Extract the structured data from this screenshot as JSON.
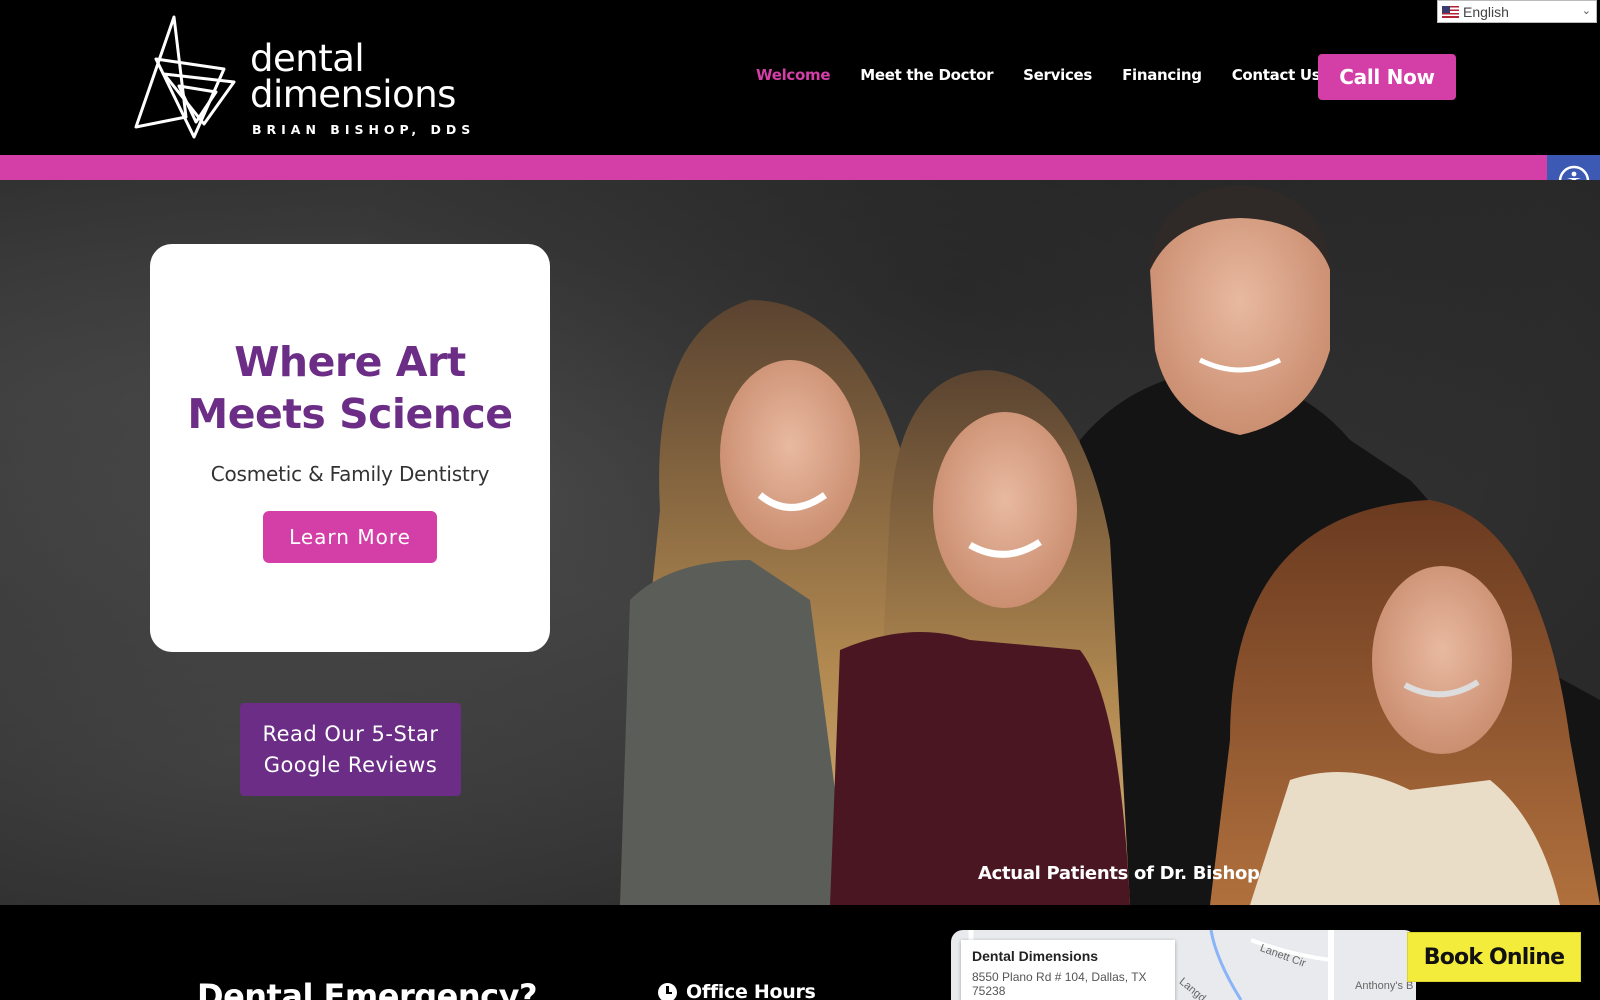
{
  "header": {
    "logo": {
      "word_line1": "dental",
      "word_line2": "dimensions",
      "subtitle": "BRIAN BISHOP, DDS"
    },
    "nav": [
      {
        "label": "Welcome",
        "active": true
      },
      {
        "label": "Meet the Doctor",
        "active": false
      },
      {
        "label": "Services",
        "active": false
      },
      {
        "label": "Financing",
        "active": false
      },
      {
        "label": "Contact Us",
        "active": false
      }
    ],
    "call_button": "Call Now",
    "language": {
      "selected": "English",
      "icon": "us-flag-icon"
    }
  },
  "accessibility": {
    "icon": "accessibility-icon"
  },
  "hero": {
    "title_line1": "Where Art",
    "title_line2": "Meets Science",
    "subtitle": "Cosmetic & Family Dentistry",
    "learn_more": "Learn More",
    "reviews_line1": "Read Our 5-Star",
    "reviews_line2": "Google Reviews",
    "caption": "Actual Patients of Dr. Bishop"
  },
  "footer": {
    "emergency_title": "Dental Emergency?",
    "office_hours": "Office Hours",
    "map": {
      "place_name": "Dental Dimensions",
      "address": "8550 Plano Rd # 104, Dallas, TX 75238",
      "street_labels": [
        "Lanett Cir",
        "Anthony's B",
        "Langd"
      ]
    },
    "book_online": "Book Online"
  },
  "colors": {
    "brand_pink": "#d43fa7",
    "brand_purple": "#6b2d86",
    "accessibility_blue": "#3c59b3",
    "book_yellow": "#f3ec3a"
  }
}
